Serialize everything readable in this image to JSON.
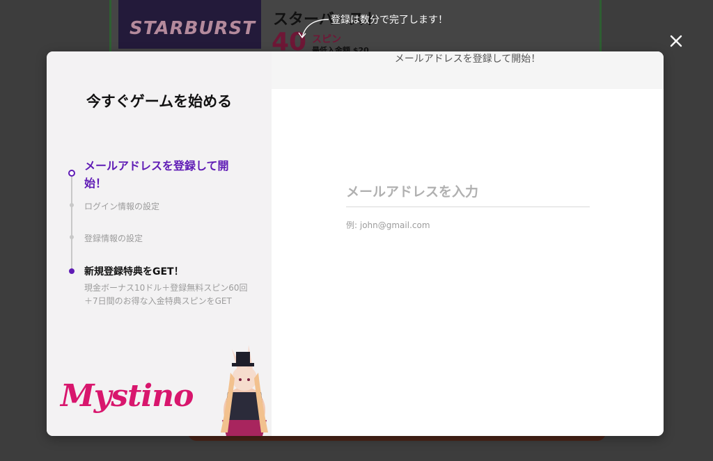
{
  "background": {
    "game_logo_text": "STARBURST",
    "title": "スターバースト",
    "spin_count": "40",
    "spin_label": "スピン",
    "min_deposit": "最低入金額 $20"
  },
  "hint": {
    "text": "登録は数分で完了します！"
  },
  "modal": {
    "title": "今すぐゲームを始める",
    "steps": [
      {
        "label": "メールアドレスを登録して開始！",
        "state": "active"
      },
      {
        "label": "ログイン情報の設定",
        "state": "pending"
      },
      {
        "label": "登録情報の設定",
        "state": "pending"
      },
      {
        "label": "新規登録特典をGET！",
        "description": "現金ボーナス10ドル＋登録無料スピン60回＋7日間のお得な入金特典スピンをGET",
        "state": "bonus"
      }
    ],
    "logo_text": "Mystino",
    "right_header": "メールアドレスを登録して開始！",
    "email": {
      "value": "",
      "placeholder": "メールアドレスを入力",
      "example": "例: john@gmail.com"
    }
  },
  "colors": {
    "accent": "#5f1bb5",
    "brand": "#d8166d",
    "overlay": "#3d3d3d"
  },
  "icons": {
    "close": "close-icon",
    "arrow": "curved-arrow-icon"
  }
}
